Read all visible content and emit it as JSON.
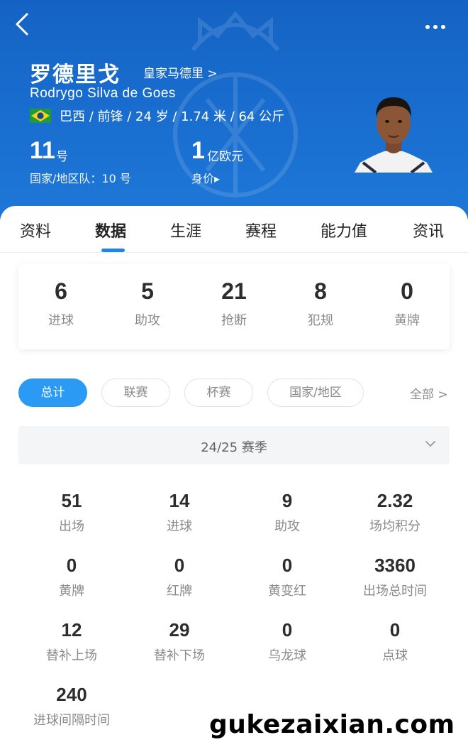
{
  "header": {
    "name_cn": "罗德里戈",
    "club": "皇家马德里 >",
    "name_en": "Rodrygo Silva de Goes",
    "info": "巴西 / 前锋 / 24 岁 / 1.74 米 / 64 公斤",
    "shirt_number": "11",
    "shirt_unit": "号",
    "national_team": "国家/地区队：10 号",
    "value_number": "1",
    "value_unit": "亿欧元",
    "value_label": "身价▸"
  },
  "tabs": [
    {
      "label": "资料"
    },
    {
      "label": "数据"
    },
    {
      "label": "生涯"
    },
    {
      "label": "赛程"
    },
    {
      "label": "能力值"
    },
    {
      "label": "资讯"
    }
  ],
  "summary": [
    {
      "value": "6",
      "label": "进球"
    },
    {
      "value": "5",
      "label": "助攻"
    },
    {
      "value": "21",
      "label": "抢断"
    },
    {
      "value": "8",
      "label": "犯规"
    },
    {
      "value": "0",
      "label": "黄牌"
    }
  ],
  "filters": [
    {
      "label": "总计"
    },
    {
      "label": "联赛"
    },
    {
      "label": "杯赛"
    },
    {
      "label": "国家/地区"
    }
  ],
  "all_label": "全部 >",
  "season": "24/25 赛季",
  "stats": [
    {
      "value": "51",
      "label": "出场"
    },
    {
      "value": "14",
      "label": "进球"
    },
    {
      "value": "9",
      "label": "助攻"
    },
    {
      "value": "2.32",
      "label": "场均积分"
    },
    {
      "value": "0",
      "label": "黄牌"
    },
    {
      "value": "0",
      "label": "红牌"
    },
    {
      "value": "0",
      "label": "黄变红"
    },
    {
      "value": "3360",
      "label": "出场总时间"
    },
    {
      "value": "12",
      "label": "替补上场"
    },
    {
      "value": "29",
      "label": "替补下场"
    },
    {
      "value": "0",
      "label": "乌龙球"
    },
    {
      "value": "0",
      "label": "点球"
    },
    {
      "value": "240",
      "label": "进球间隔时间"
    }
  ],
  "watermark": "gukezaixian.com",
  "colors": {
    "header_blue": "#1a6fd0",
    "accent_blue": "#2a9af5",
    "tab_underline": "#1e84f0"
  }
}
